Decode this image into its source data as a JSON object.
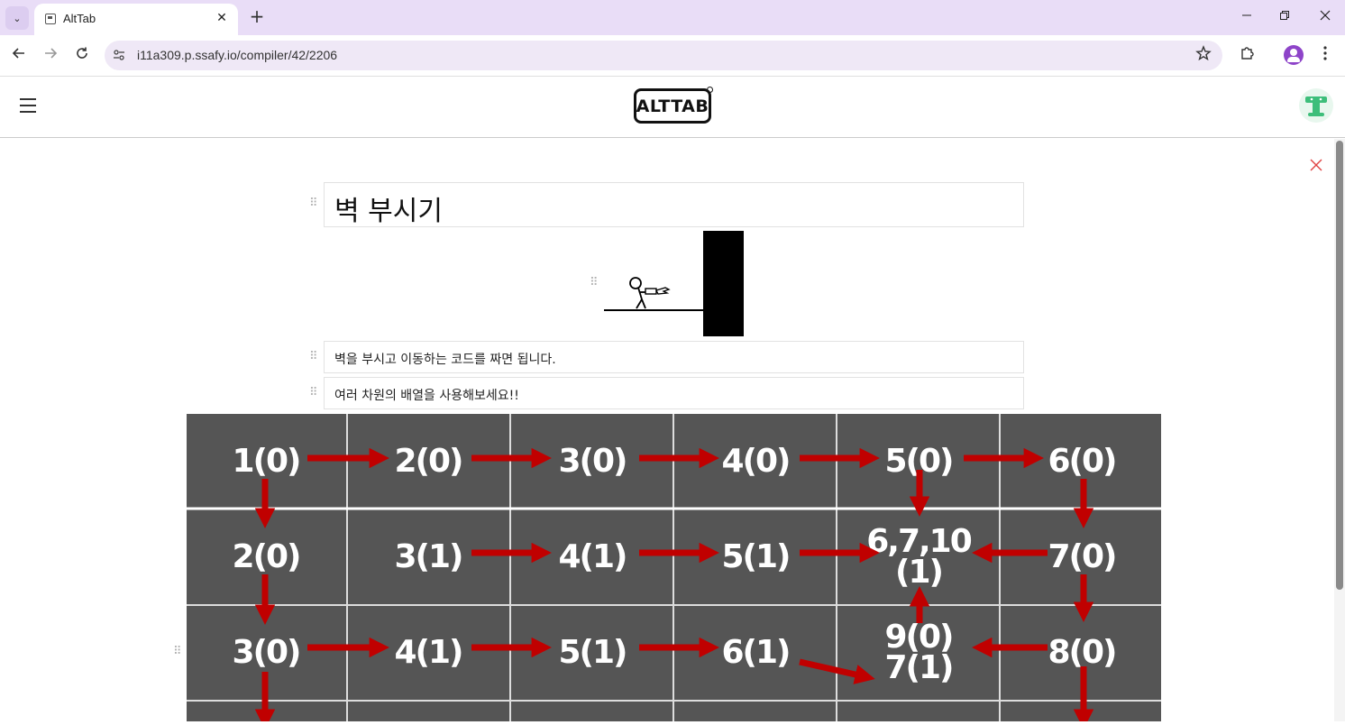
{
  "browser": {
    "tab_title": "AltTab",
    "url": "i11a309.p.ssafy.io/compiler/42/2206",
    "tab_close_glyph": "✕",
    "new_tab_glyph": "+"
  },
  "app": {
    "logo_text": "ALTTAB"
  },
  "doc": {
    "title": "벽 부시기",
    "line1": "벽을 부시고 이동하는 코드를 짜면 됩니다.",
    "line2": "여러 차원의 배열을 사용해보세요!!"
  },
  "grid": {
    "rows": [
      [
        "1(0)",
        "2(0)",
        "3(0)",
        "4(0)",
        "5(0)",
        "6(0)"
      ],
      [
        "2(0)",
        "3(1)",
        "4(1)",
        "5(1)",
        "6,7,10\n(1)",
        "7(0)"
      ],
      [
        "3(0)",
        "4(1)",
        "5(1)",
        "6(1)",
        "9(0)\n7(1)",
        "8(0)"
      ]
    ],
    "colors": {
      "background": "#555555",
      "line": "#ffffff",
      "arrow": "#c00000",
      "text": "#ffffff"
    }
  },
  "colors": {
    "tabbar": "#e9ddf7",
    "omnibox": "#efe8f6",
    "close_x": "#e04444",
    "avatar_accent": "#3dbe7a"
  }
}
